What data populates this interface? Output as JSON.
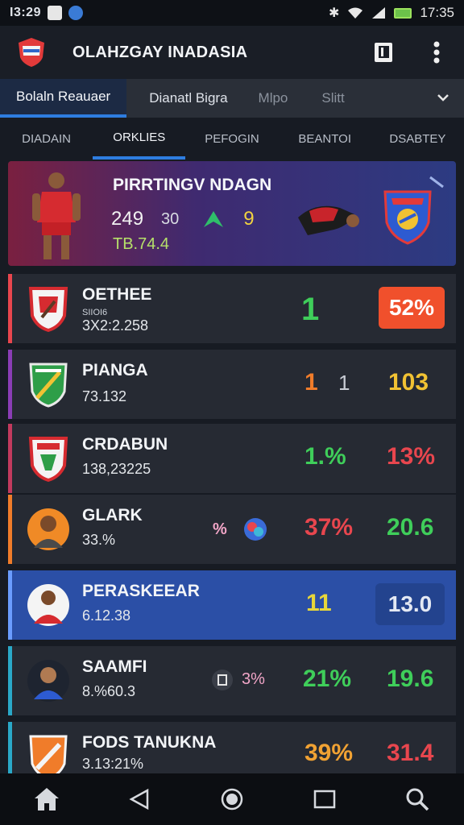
{
  "status_bar": {
    "left_time": "I3:29",
    "right_time": "17:35"
  },
  "app_bar": {
    "title": "OLAHZGAY INADASIA"
  },
  "primary_tabs": [
    {
      "label": "Bolaln Reauaer",
      "active": true
    },
    {
      "label": "Dianatl Bigra",
      "active": false
    },
    {
      "label": "Mlpo",
      "active": false
    },
    {
      "label": "Slitt",
      "active": false
    }
  ],
  "secondary_tabs": [
    {
      "label": "DIADAIN",
      "active": false
    },
    {
      "label": "ORKLIES",
      "active": true
    },
    {
      "label": "PEFOGIN",
      "active": false
    },
    {
      "label": "BEANTOI",
      "active": false
    },
    {
      "label": "DSABTEY",
      "active": false
    }
  ],
  "hero": {
    "title": "PIRRTINGV NDAGN",
    "stat_a": "249",
    "stat_b": "30",
    "stat_c": "9",
    "subline": "TB.74.4"
  },
  "rows": [
    {
      "name": "OETHEE",
      "meta": "SIIOI6",
      "sub": "3X2:2.258",
      "mid": "1",
      "value": "52%"
    },
    {
      "name": "PIANGA",
      "sub": "73.132",
      "mid_a": "1",
      "mid_b": "1",
      "value": "103"
    },
    {
      "name": "CRDABUN",
      "sub": "138,23225",
      "mid": "1.%",
      "value": "13%"
    },
    {
      "name": "GLARK",
      "sub": "33.%",
      "extra": "%",
      "mid": "37%",
      "value": "20.6"
    },
    {
      "name": "PERASKEEAR",
      "sub": "6.12.38",
      "mid": "11",
      "value": "13.0"
    },
    {
      "name": "SAAMFI",
      "sub": "8.%60.3",
      "extra": "3%",
      "mid": "21%",
      "value": "19.6"
    },
    {
      "name": "FODS TANUKNA",
      "sub": "3.13:21%",
      "mid": "39%",
      "value": "31.4"
    }
  ],
  "colors": {
    "accent_blue": "#2e7de0",
    "green": "#3fce5a",
    "red": "#e8464e",
    "orange": "#f07c2a",
    "yellow": "#f1c233",
    "pill_orange": "#f0502c"
  },
  "icons": {
    "app_logo": "shield-flag-logo",
    "book": "book-icon",
    "more": "more-vertical-icon",
    "chevron": "chevron-down-icon",
    "home": "home-icon",
    "back": "back-triangle-icon",
    "circle": "home-circle-icon",
    "square": "recents-square-icon",
    "search": "search-icon"
  }
}
